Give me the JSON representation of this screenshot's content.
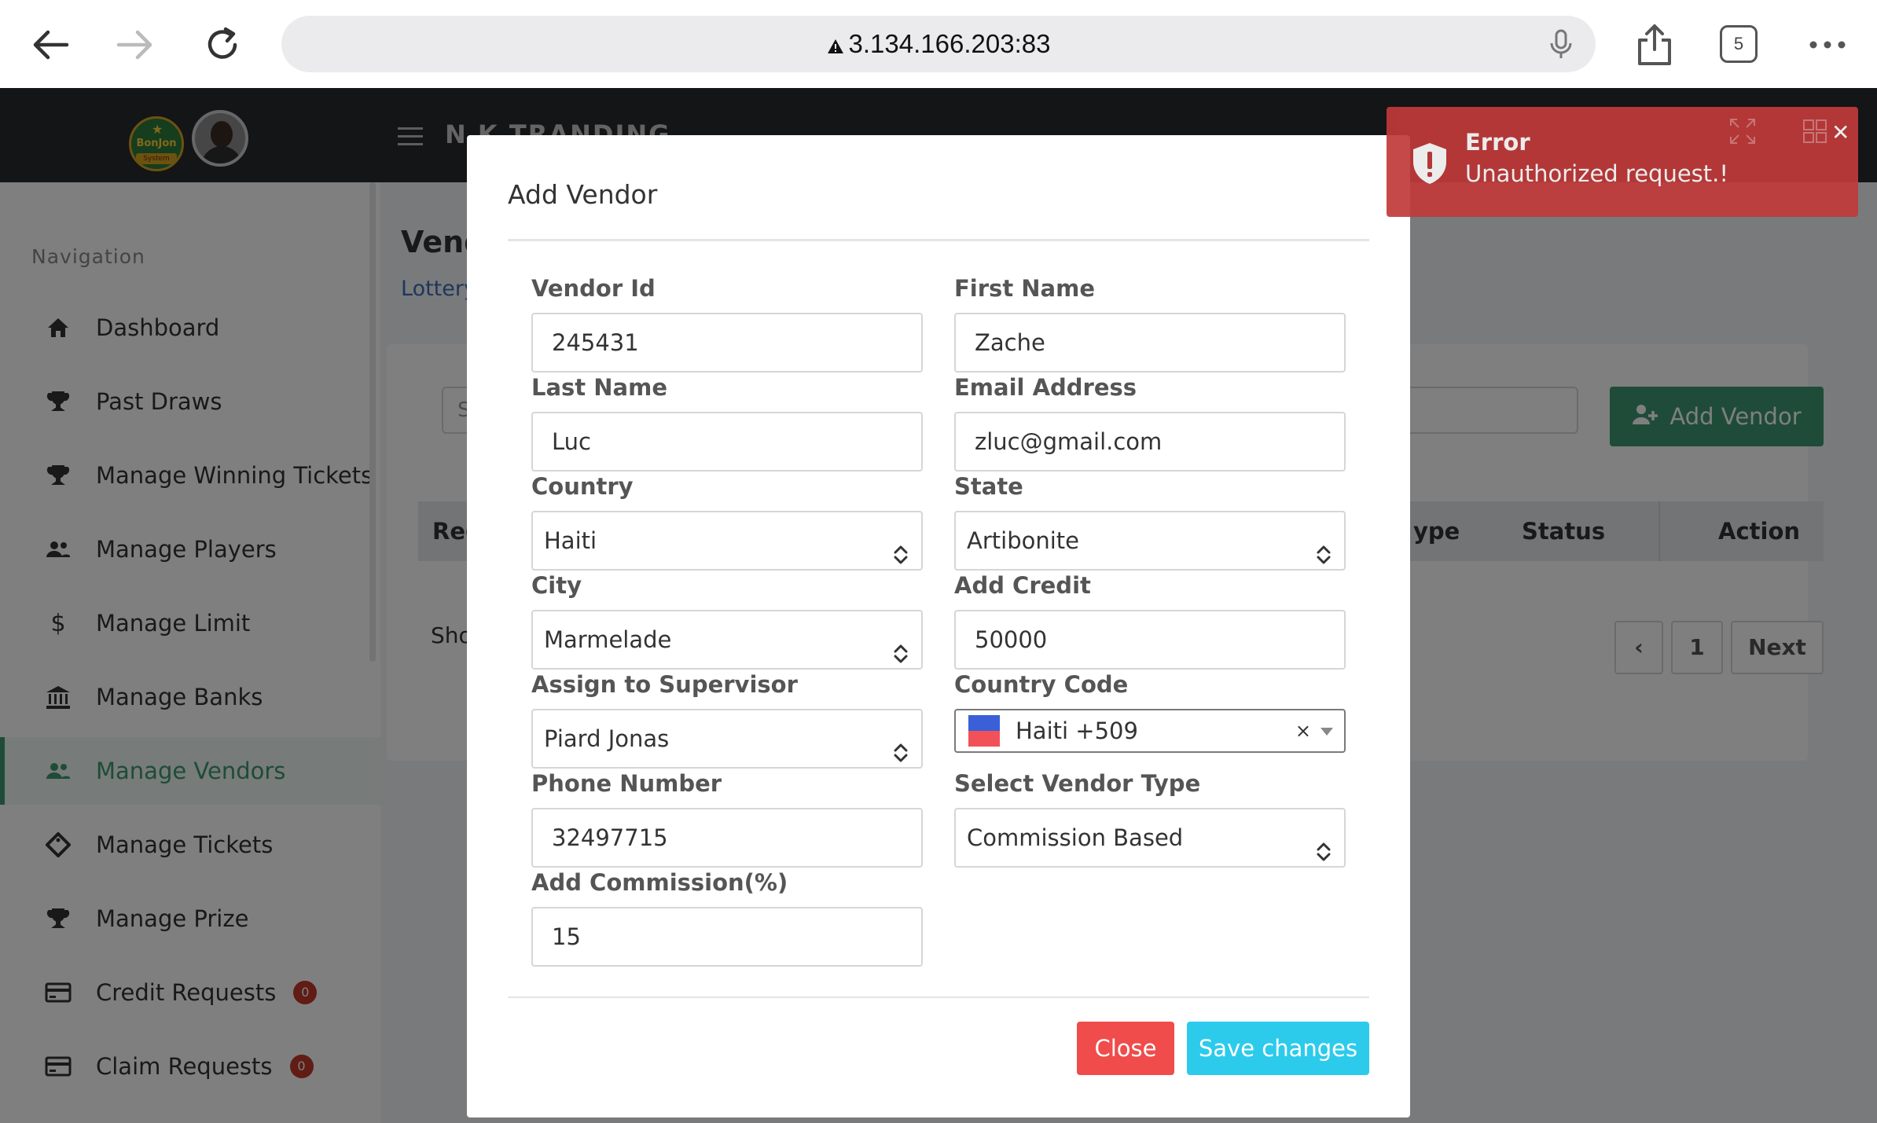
{
  "browser": {
    "url": "3.134.166.203:83",
    "tab_count": "5"
  },
  "header": {
    "brand": "N K TRANDING",
    "logo_text": "BonJon",
    "logo_sub": "System"
  },
  "sidebar": {
    "title": "Navigation",
    "items": [
      {
        "label": "Dashboard",
        "icon": "home-icon"
      },
      {
        "label": "Past Draws",
        "icon": "trophy-icon"
      },
      {
        "label": "Manage Winning Tickets",
        "icon": "trophy-icon"
      },
      {
        "label": "Manage Players",
        "icon": "users-icon"
      },
      {
        "label": "Manage Limit",
        "icon": "dollar-icon"
      },
      {
        "label": "Manage Banks",
        "icon": "bank-icon"
      },
      {
        "label": "Manage Vendors",
        "icon": "users-icon",
        "active": true
      },
      {
        "label": "Manage Tickets",
        "icon": "ticket-icon"
      },
      {
        "label": "Manage Prize",
        "icon": "trophy-icon"
      },
      {
        "label": "Credit Requests",
        "icon": "card-icon",
        "badge": "0"
      },
      {
        "label": "Claim Requests",
        "icon": "card-icon",
        "badge": "0"
      }
    ]
  },
  "page": {
    "title": "Vend",
    "breadcrumb": "Lottery",
    "search_placeholder": "S",
    "add_button": "Add Vendor",
    "columns": [
      "Reg",
      "ype",
      "Status",
      "Action"
    ],
    "show_text": "Sho",
    "pager": {
      "prev": "‹",
      "page": "1",
      "next": "Next"
    }
  },
  "modal": {
    "title": "Add Vendor",
    "fields": {
      "vendor_id": {
        "label": "Vendor Id",
        "value": "245431"
      },
      "first_name": {
        "label": "First Name",
        "value": "Zache"
      },
      "last_name": {
        "label": "Last Name",
        "value": "Luc"
      },
      "email": {
        "label": "Email Address",
        "value": "zluc@gmail.com"
      },
      "country": {
        "label": "Country",
        "value": "Haiti"
      },
      "state": {
        "label": "State",
        "value": "Artibonite"
      },
      "city": {
        "label": "City",
        "value": "Marmelade"
      },
      "credit": {
        "label": "Add Credit",
        "value": "50000"
      },
      "supervisor": {
        "label": "Assign to Supervisor",
        "value": "Piard Jonas"
      },
      "country_code": {
        "label": "Country Code",
        "value": "Haiti +509"
      },
      "phone": {
        "label": "Phone Number",
        "value": "32497715"
      },
      "vendor_type": {
        "label": "Select Vendor Type",
        "value": "Commission Based"
      },
      "commission": {
        "label": "Add Commission(%)",
        "value": "15"
      }
    },
    "close_label": "Close",
    "save_label": "Save changes"
  },
  "toast": {
    "title": "Error",
    "message": "Unauthorized request.!"
  },
  "colors": {
    "accent": "#3d9970",
    "danger": "#f04c4c",
    "info": "#2ccbec",
    "toast": "#c13a3a",
    "header": "#262a2f"
  }
}
